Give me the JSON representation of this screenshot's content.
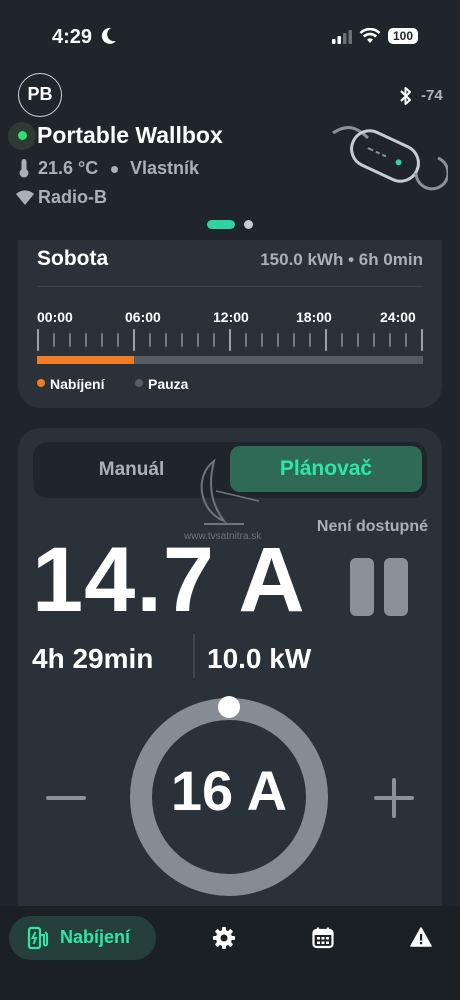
{
  "status_bar": {
    "time": "4:29",
    "battery": "100"
  },
  "header": {
    "avatar_initials": "PB",
    "bluetooth_rssi": "-74",
    "device_name": "Portable Wallbox",
    "temperature": "21.6 °C",
    "role": "Vlastník",
    "network": "Radio-B",
    "status_color": "#2ee06c"
  },
  "schedule": {
    "day": "Sobota",
    "summary": "150.0 kWh • 6h 0min",
    "ticks": [
      "00:00",
      "06:00",
      "12:00",
      "18:00",
      "24:00"
    ],
    "charging_fraction": 0.25,
    "legend_charging": "Nabíjení",
    "legend_pause": "Pauza",
    "charging_color": "#f07b26"
  },
  "mode": {
    "manual_label": "Manuál",
    "planner_label": "Plánovač",
    "selected": "Plánovač"
  },
  "watermark": "www.tvsatnitra.sk",
  "charging": {
    "unavailable_label": "Není dostupné",
    "current": "14.7 A",
    "duration": "4h 29min",
    "power": "10.0 kW",
    "set_current": "16 A"
  },
  "nav": {
    "charging_label": "Nabíjení",
    "accent_color": "#2ee6a6"
  }
}
